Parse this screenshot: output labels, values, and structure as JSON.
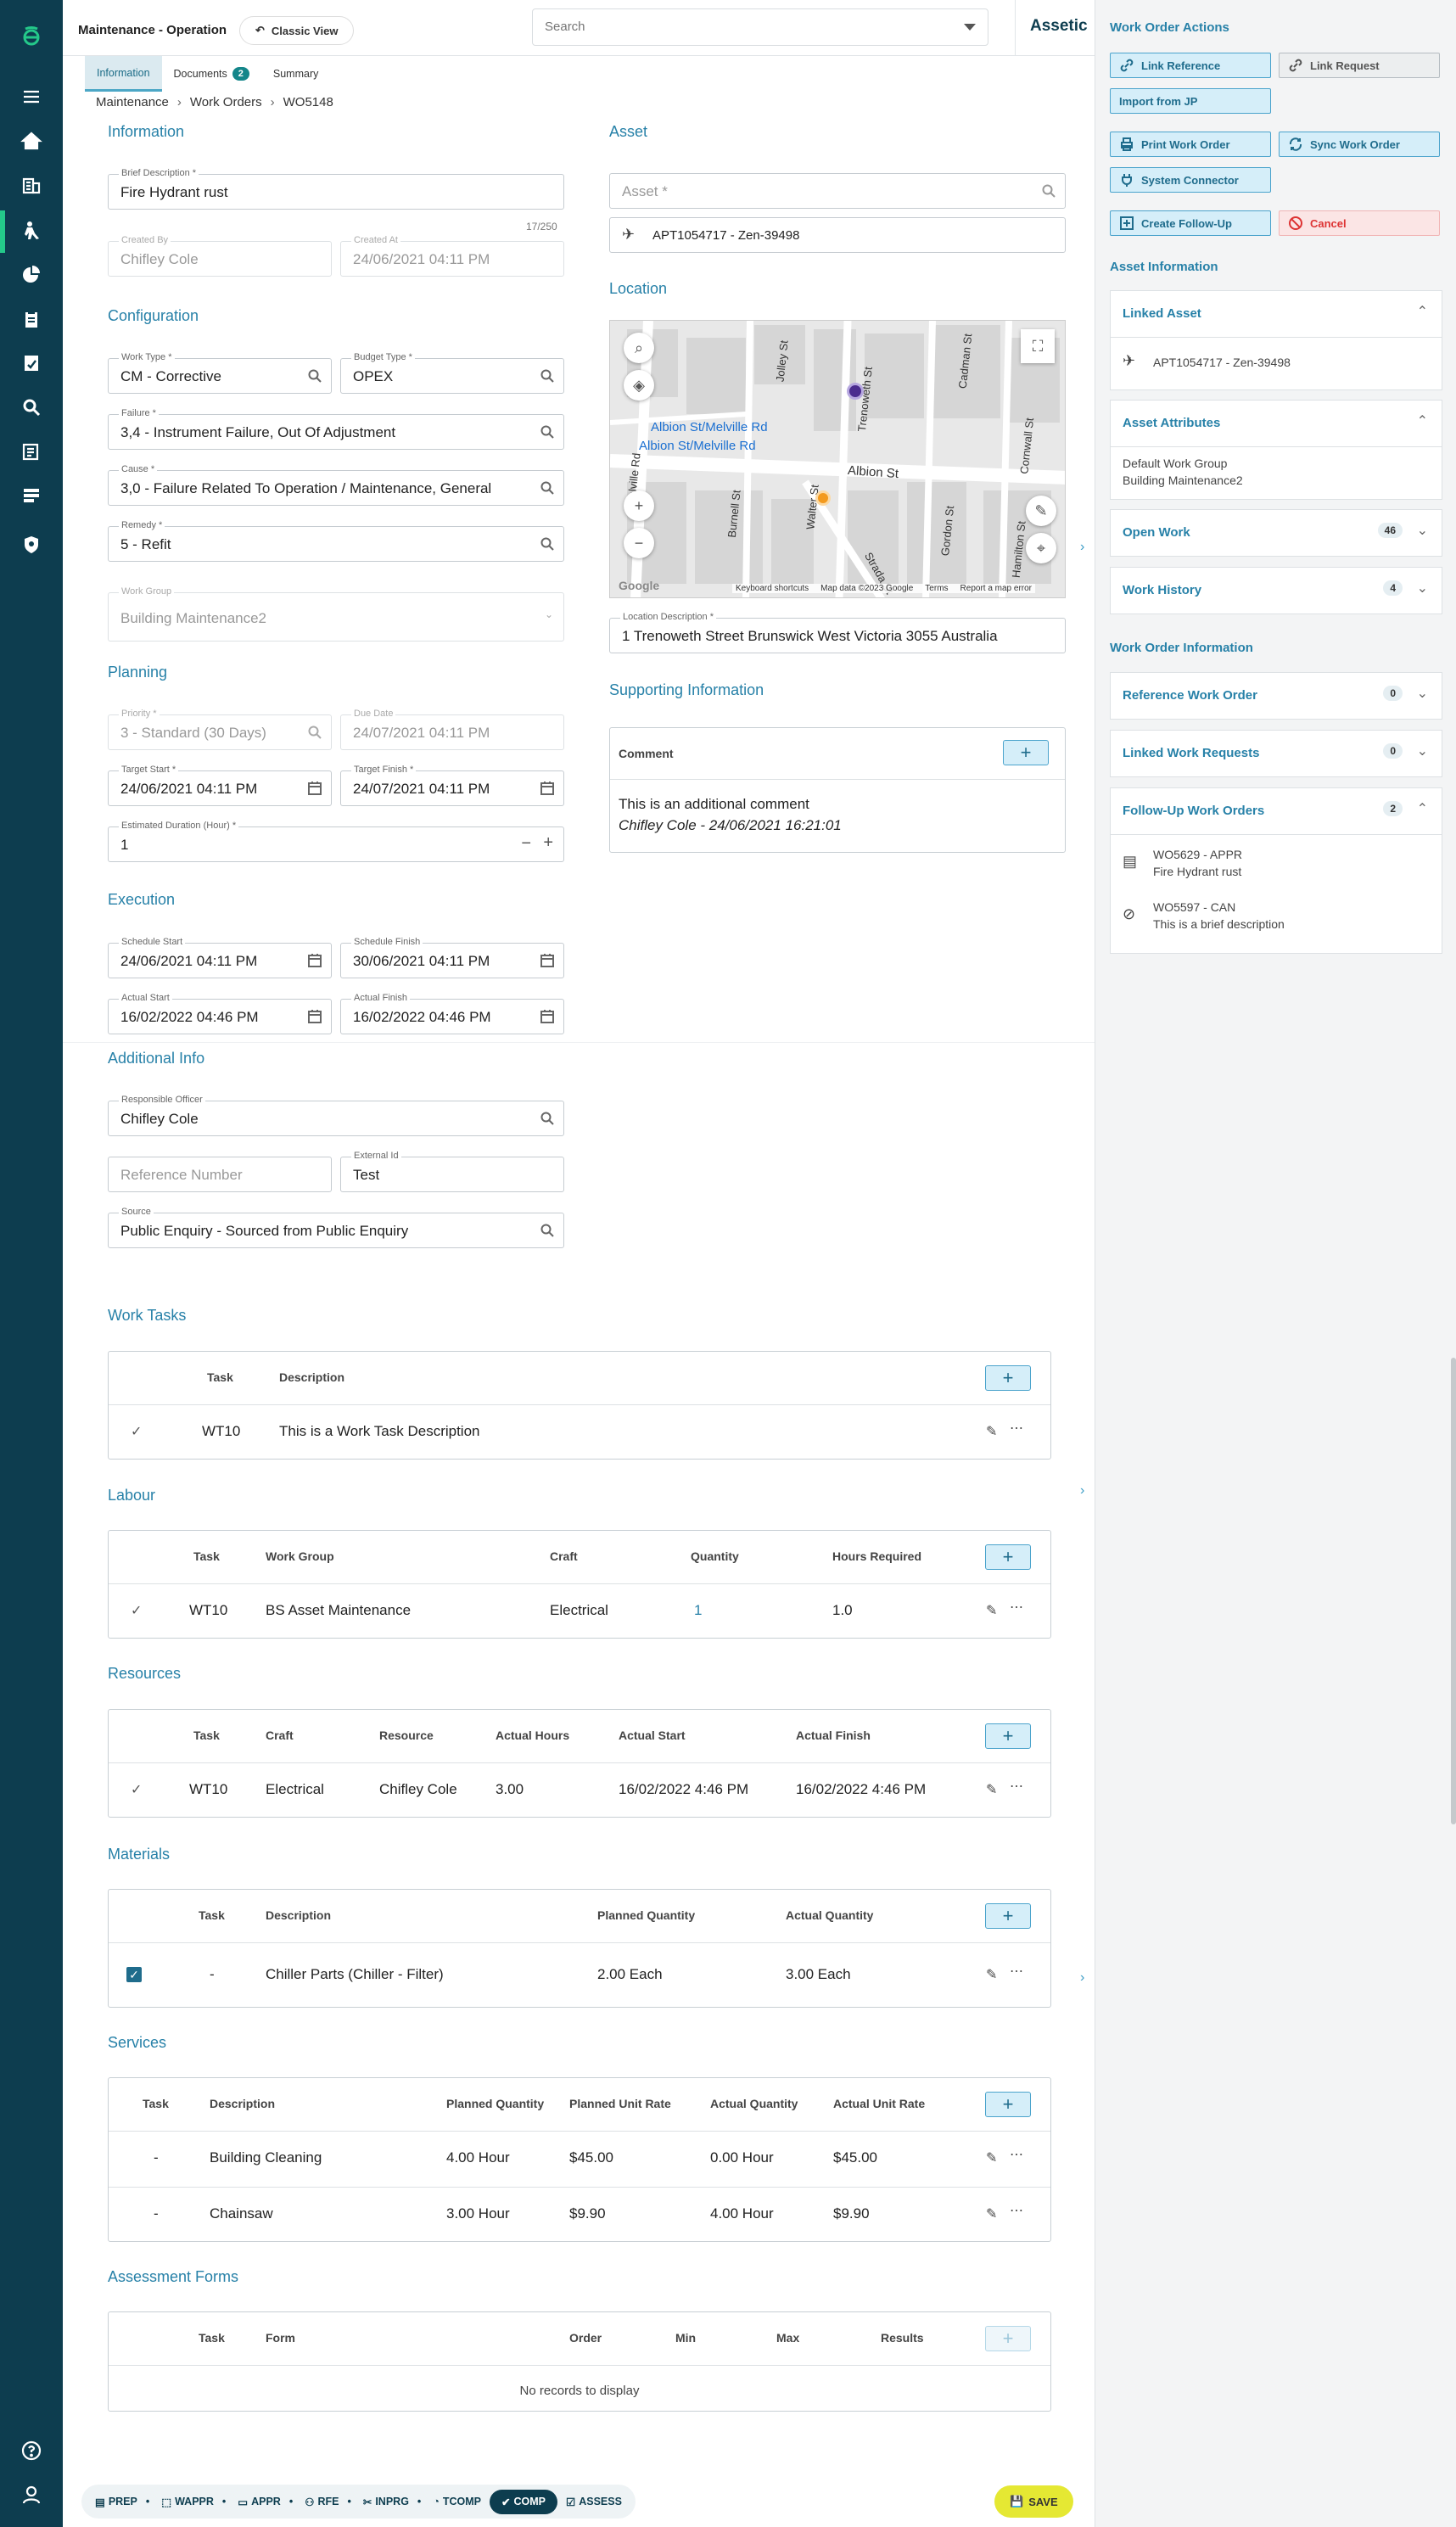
{
  "nav": {
    "items": [
      "logo-icon",
      "menu-icon",
      "home-icon",
      "building-icon",
      "worker-icon",
      "pie-chart-icon",
      "clipboard-icon",
      "notepad-icon",
      "search-icon",
      "document-list-icon",
      "list-icon",
      "shield-icon",
      "help-icon",
      "user-icon"
    ]
  },
  "header": {
    "title": "Maintenance - Operation",
    "classic_view": "Classic View",
    "search_placeholder": "Search",
    "brand": "Assetic"
  },
  "tabs": [
    {
      "label": "Information"
    },
    {
      "label": "Documents",
      "badge": "2"
    },
    {
      "label": "Summary"
    }
  ],
  "breadcrumb": [
    "Maintenance",
    "Work Orders",
    "WO5148"
  ],
  "information": {
    "title": "Information",
    "brief_label": "Brief Description *",
    "brief_value": "Fire Hydrant rust",
    "counter": "17/250",
    "created_by_label": "Created By",
    "created_by": "Chifley Cole",
    "created_at_label": "Created At",
    "created_at": "24/06/2021 04:11 PM"
  },
  "configuration": {
    "title": "Configuration",
    "work_type_label": "Work Type *",
    "work_type": "CM - Corrective",
    "budget_type_label": "Budget Type *",
    "budget_type": "OPEX",
    "failure_label": "Failure *",
    "failure": "3,4 - Instrument Failure, Out Of Adjustment",
    "cause_label": "Cause *",
    "cause": "3,0 - Failure Related To Operation / Maintenance, General",
    "remedy_label": "Remedy *",
    "remedy": "5 - Refit",
    "work_group_label": "Work Group",
    "work_group": "Building Maintenance2"
  },
  "planning": {
    "title": "Planning",
    "priority_label": "Priority *",
    "priority": "3 - Standard (30 Days)",
    "due_label": "Due Date",
    "due": "24/07/2021 04:11 PM",
    "target_start_label": "Target Start *",
    "target_start": "24/06/2021 04:11 PM",
    "target_finish_label": "Target Finish *",
    "target_finish": "24/07/2021 04:11 PM",
    "duration_label": "Estimated Duration (Hour) *",
    "duration": "1"
  },
  "execution": {
    "title": "Execution",
    "schedule_start_label": "Schedule Start",
    "schedule_start": "24/06/2021 04:11 PM",
    "schedule_finish_label": "Schedule Finish",
    "schedule_finish": "30/06/2021 04:11 PM",
    "actual_start_label": "Actual Start",
    "actual_start": "16/02/2022 04:46 PM",
    "actual_finish_label": "Actual Finish",
    "actual_finish": "16/02/2022 04:46 PM"
  },
  "additional": {
    "title": "Additional Info",
    "officer_label": "Responsible Officer",
    "officer": "Chifley Cole",
    "ref_placeholder": "Reference Number",
    "external_label": "External Id",
    "external": "Test",
    "source_label": "Source",
    "source": "Public Enquiry - Sourced from Public Enquiry"
  },
  "asset": {
    "title": "Asset",
    "asset_placeholder": "Asset *",
    "asset_value": "APT1054717 - Zen-39498"
  },
  "location": {
    "title": "Location",
    "description_label": "Location Description *",
    "description": "1 Trenoweth Street Brunswick West Victoria 3055 Australia",
    "map": {
      "streets": [
        "Albion St",
        "Albion St/Melville Rd",
        "Albion St/Melville Rd",
        "Trenoweth St",
        "Jolley St",
        "Cadman St",
        "Gordon St",
        "Walter St",
        "Cornwall St",
        "Hamilton St",
        "Burnell St",
        "Melville Rd",
        "Strada St"
      ],
      "attribution": [
        "Keyboard shortcuts",
        "Map data ©2023 Google",
        "Terms",
        "Report a map error"
      ],
      "google": "Google"
    }
  },
  "supporting": {
    "title": "Supporting Information",
    "comment_header": "Comment",
    "comment_text": "This is an additional comment",
    "comment_meta": "Chifley Cole - 24/06/2021 16:21:01"
  },
  "work_tasks": {
    "title": "Work Tasks",
    "headers": [
      "Task",
      "Description"
    ],
    "rows": [
      {
        "task": "WT10",
        "description": "This is a Work Task Description"
      }
    ]
  },
  "labour": {
    "title": "Labour",
    "headers": [
      "Task",
      "Work Group",
      "Craft",
      "Quantity",
      "Hours Required"
    ],
    "rows": [
      {
        "task": "WT10",
        "group": "BS Asset Maintenance",
        "craft": "Electrical",
        "qty": "1",
        "hours": "1.0"
      }
    ]
  },
  "resources": {
    "title": "Resources",
    "headers": [
      "Task",
      "Craft",
      "Resource",
      "Actual Hours",
      "Actual Start",
      "Actual Finish"
    ],
    "rows": [
      {
        "task": "WT10",
        "craft": "Electrical",
        "resource": "Chifley Cole",
        "hours": "3.00",
        "start": "16/02/2022 4:46 PM",
        "finish": "16/02/2022 4:46 PM"
      }
    ]
  },
  "materials": {
    "title": "Materials",
    "headers": [
      "Task",
      "Description",
      "Planned Quantity",
      "Actual Quantity"
    ],
    "rows": [
      {
        "task": "-",
        "description": "Chiller Parts (Chiller - Filter)",
        "planned": "2.00 Each",
        "actual": "3.00 Each"
      }
    ]
  },
  "services": {
    "title": "Services",
    "headers": [
      "Task",
      "Description",
      "Planned Quantity",
      "Planned Unit Rate",
      "Actual Quantity",
      "Actual Unit Rate"
    ],
    "rows": [
      {
        "task": "-",
        "description": "Building Cleaning",
        "pq": "4.00 Hour",
        "pr": "$45.00",
        "aq": "0.00 Hour",
        "ar": "$45.00"
      },
      {
        "task": "-",
        "description": "Chainsaw",
        "pq": "3.00 Hour",
        "pr": "$9.90",
        "aq": "4.00 Hour",
        "ar": "$9.90"
      }
    ]
  },
  "assessment": {
    "title": "Assessment Forms",
    "headers": [
      "Task",
      "Form",
      "Order",
      "Min",
      "Max",
      "Results"
    ],
    "empty": "No records to display"
  },
  "footer": {
    "stages": [
      "PREP",
      "WAPPR",
      "APPR",
      "RFE",
      "INPRG",
      "TCOMP",
      "COMP",
      "ASSESS"
    ],
    "active_stage": "COMP",
    "save": "SAVE"
  },
  "right_panel": {
    "actions_title": "Work Order Actions",
    "buttons": {
      "link_reference": "Link Reference",
      "link_request": "Link Request",
      "import_jp": "Import from JP",
      "print": "Print Work Order",
      "sync": "Sync Work Order",
      "system_connector": "System Connector",
      "follow_up": "Create Follow-Up",
      "cancel": "Cancel"
    },
    "asset_info_title": "Asset Information",
    "linked_asset": "Linked Asset",
    "linked_asset_value": "APT1054717 - Zen-39498",
    "asset_attributes": "Asset Attributes",
    "attr_line1": "Default Work Group",
    "attr_line2": "Building Maintenance2",
    "open_work": "Open Work",
    "open_work_count": "46",
    "work_history": "Work History",
    "work_history_count": "4",
    "wo_info_title": "Work Order Information",
    "ref_wo": "Reference Work Order",
    "ref_wo_count": "0",
    "linked_wr": "Linked Work Requests",
    "linked_wr_count": "0",
    "follow_up_wo": "Follow-Up Work Orders",
    "follow_up_count": "2",
    "followups": [
      {
        "code": "WO5629 - APPR",
        "desc": "Fire Hydrant rust"
      },
      {
        "code": "WO5597 - CAN",
        "desc": "This is a brief description"
      }
    ]
  }
}
